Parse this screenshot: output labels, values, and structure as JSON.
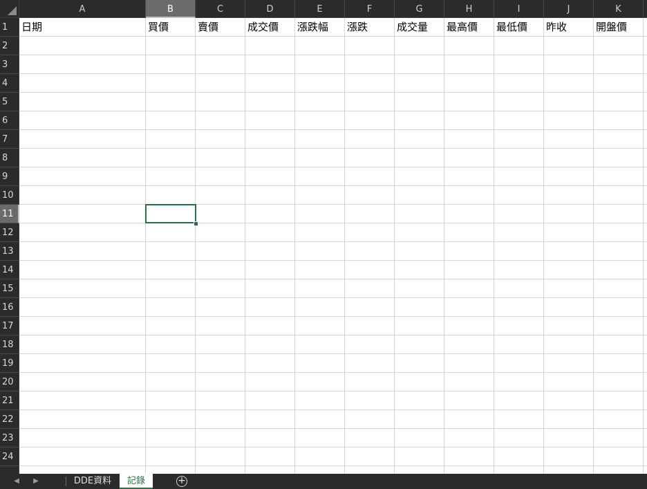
{
  "columns": [
    "A",
    "B",
    "C",
    "D",
    "E",
    "F",
    "G",
    "H",
    "I",
    "J",
    "K"
  ],
  "rows": [
    "1",
    "2",
    "3",
    "4",
    "5",
    "6",
    "7",
    "8",
    "9",
    "10",
    "11",
    "12",
    "13",
    "14",
    "15",
    "16",
    "17",
    "18",
    "19",
    "20",
    "21",
    "22",
    "23",
    "24"
  ],
  "headers": [
    "日期",
    "買價",
    "賣價",
    "成交價",
    "漲跌幅",
    "漲跌",
    "成交量",
    "最高價",
    "最低價",
    "昨收",
    "開盤價"
  ],
  "selected_cell": "B11",
  "sheet_tabs": [
    {
      "label": "DDE資料",
      "active": false
    },
    {
      "label": "記錄",
      "active": true
    }
  ],
  "colors": {
    "accent": "#217346",
    "header_bg": "#2b2b2b",
    "grid": "#d6d6d6"
  }
}
